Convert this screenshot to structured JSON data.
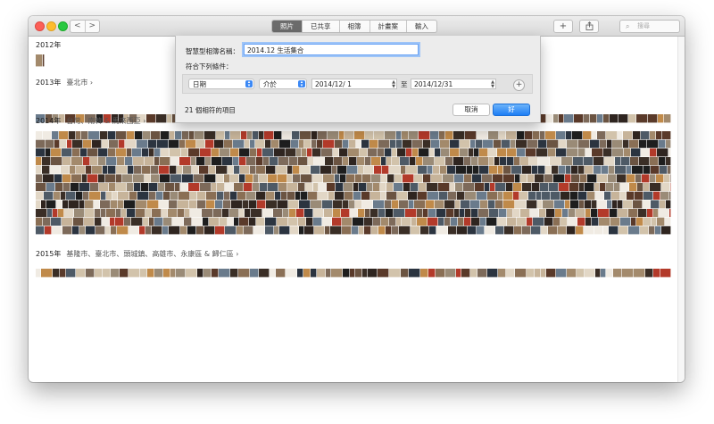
{
  "toolbar": {
    "nav_back": "<",
    "nav_forward": ">",
    "tabs": [
      {
        "label": "照片",
        "active": true
      },
      {
        "label": "已共享",
        "active": false
      },
      {
        "label": "相簿",
        "active": false
      },
      {
        "label": "計畫案",
        "active": false
      },
      {
        "label": "輸入",
        "active": false
      }
    ],
    "add_button": "+",
    "share_icon": "share-icon",
    "search_placeholder": "搜尋"
  },
  "library": {
    "sections": [
      {
        "year": "2012年",
        "places": ""
      },
      {
        "year": "2013年",
        "places": "臺北市 ›"
      },
      {
        "year": "2014年",
        "places": "台灣、南韓 & 馬來西亞 ›"
      },
      {
        "year": "2015年",
        "places": "基隆市、臺北市、頭城鎮、高雄市、永康區 & 歸仁區 ›"
      }
    ]
  },
  "dialog": {
    "name_label": "智慧型相簿名稱：",
    "name_value": "2014.12 生活集合",
    "match_label": "符合下列條件：",
    "rule": {
      "field": "日期",
      "operator": "介於",
      "start_date": "2014/12/  1",
      "to_label": "至",
      "end_date": "2014/12/31"
    },
    "add_rule": "+",
    "match_count": "21 個相符的項目",
    "cancel_label": "取消",
    "ok_label": "好"
  },
  "colors": {
    "accent": "#1d7ef5",
    "photo_palette": [
      "#3a2e26",
      "#6b5442",
      "#8a6f55",
      "#a38a6c",
      "#2b3440",
      "#c7b49a",
      "#5a3a2a",
      "#d2c3ab",
      "#1e1e1e",
      "#7d6a5a",
      "#b33a2a",
      "#e2d7c6",
      "#4e5a66",
      "#9a8b77",
      "#2f2520",
      "#c08a4a",
      "#6a7b8c",
      "#f0ebe3"
    ]
  }
}
